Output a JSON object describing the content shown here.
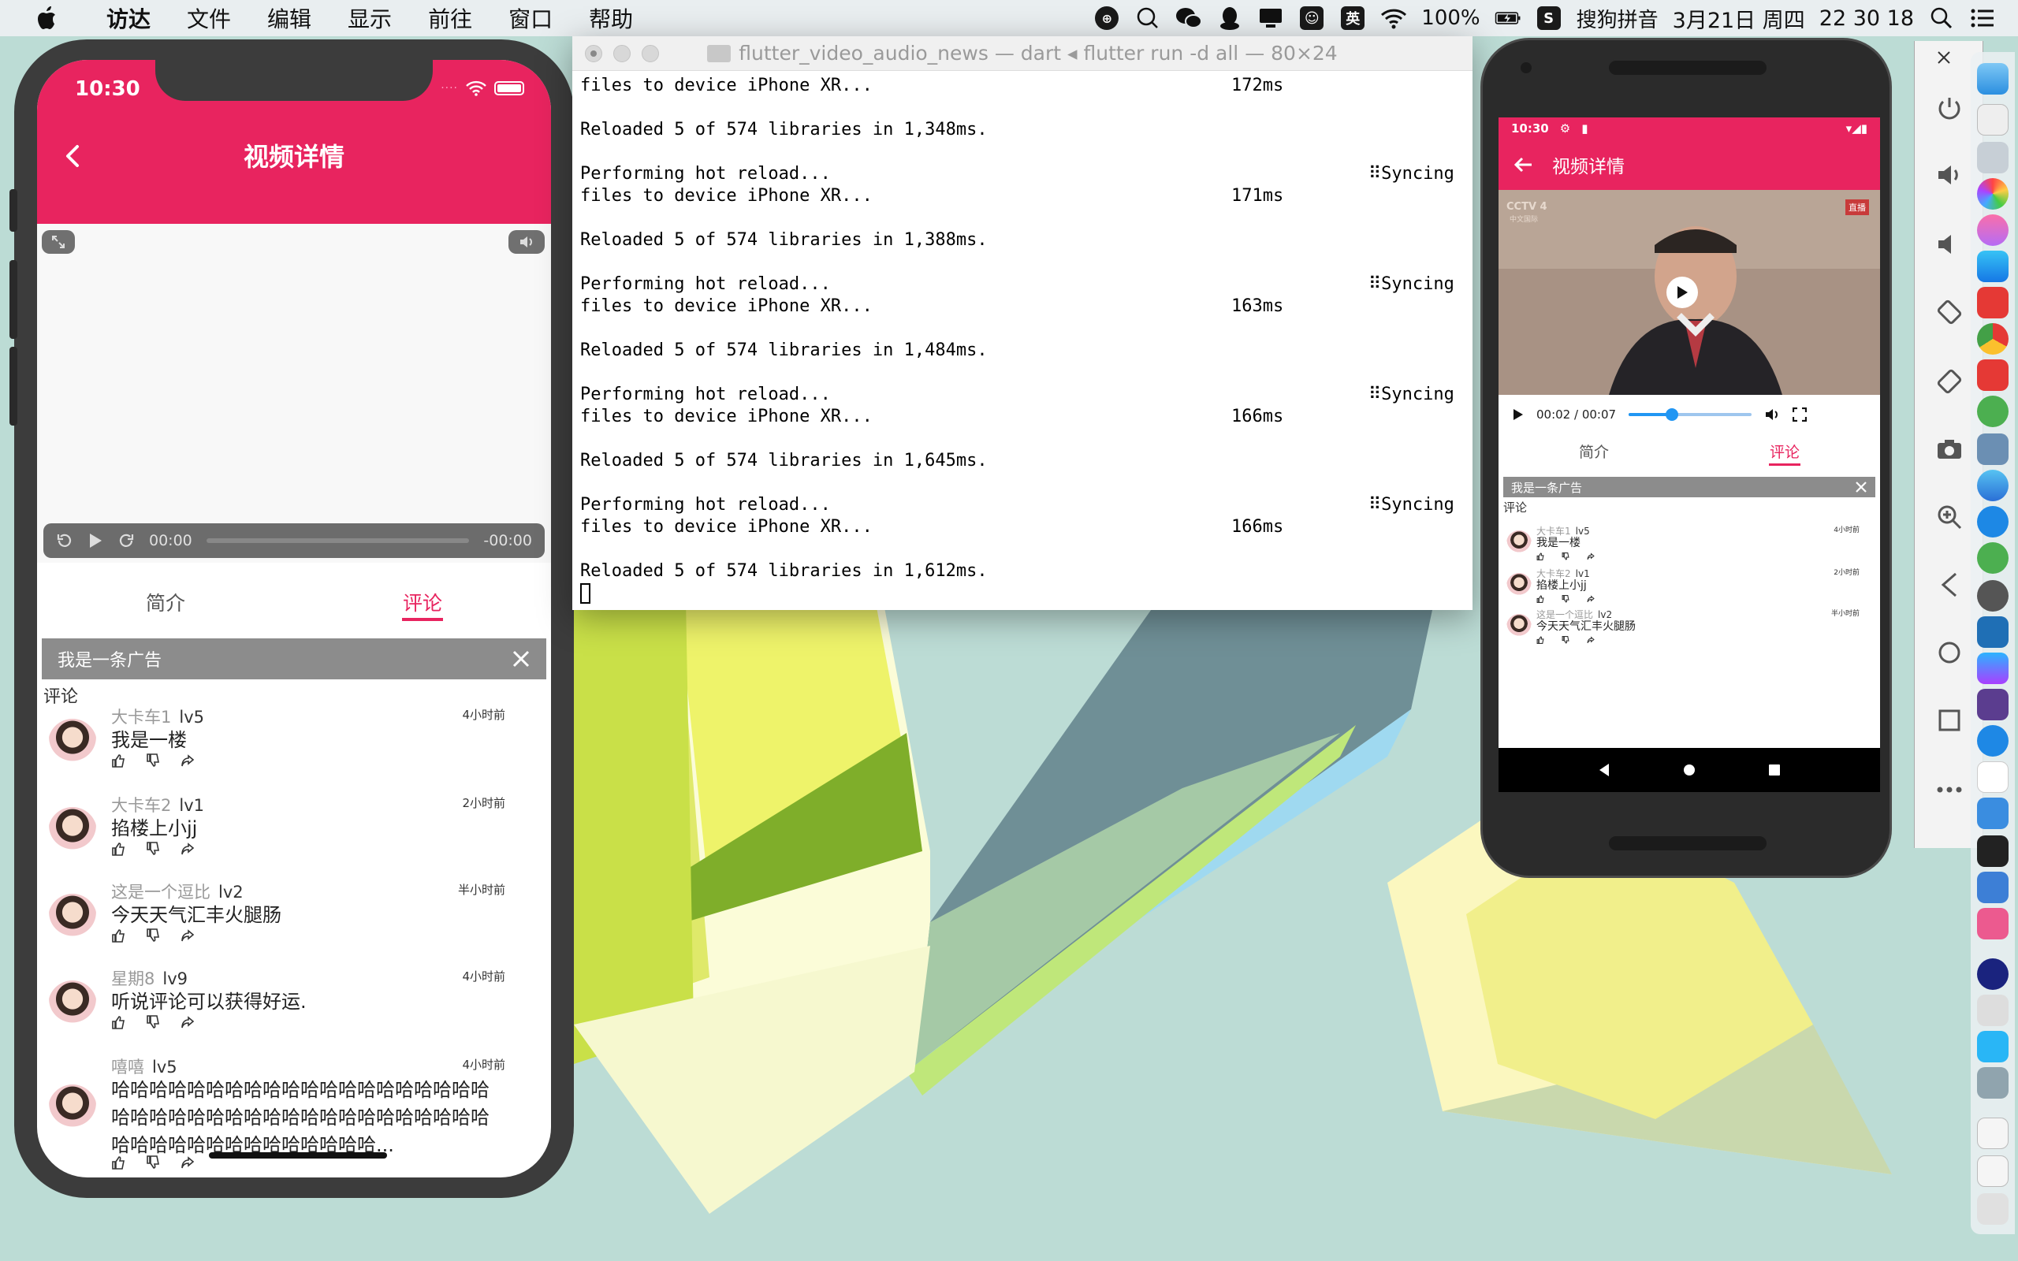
{
  "menubar": {
    "app_name": "访达",
    "menus": [
      "文件",
      "编辑",
      "显示",
      "前往",
      "窗口",
      "帮助"
    ],
    "status": {
      "battery_percent": "100%",
      "input_lang": "英",
      "ime_name": "搜狗拼音",
      "date": "3月21日 周四",
      "clock": "22 30 18"
    }
  },
  "ios": {
    "status_time": "10:30",
    "title": "视频详情",
    "player": {
      "current": "00:00",
      "remaining": "-00:00"
    },
    "tabs": [
      "简介",
      "评论"
    ],
    "active_tab": 1,
    "ad_text": "我是一条广告",
    "comments_heading": "评论",
    "comments": [
      {
        "name": "大卡车1",
        "level": "lv5",
        "time": "4小时前",
        "text": "我是一楼"
      },
      {
        "name": "大卡车2",
        "level": "lv1",
        "time": "2小时前",
        "text": "掐楼上小jj"
      },
      {
        "name": "这是一个逗比",
        "level": "lv2",
        "time": "半小时前",
        "text": "今天天气汇丰火腿肠"
      },
      {
        "name": "星期8",
        "level": "lv9",
        "time": "4小时前",
        "text": "听说评论可以获得好运."
      },
      {
        "name": "嘻嘻",
        "level": "lv5",
        "time": "4小时前",
        "text": "哈哈哈哈哈哈哈哈哈哈哈哈哈哈哈哈哈哈哈哈哈哈哈哈哈哈哈哈哈哈哈哈哈哈哈哈哈哈哈哈哈哈哈哈哈哈哈哈哈哈哈哈哈哈..."
      }
    ]
  },
  "terminal": {
    "title": "flutter_video_audio_news — dart ◂ flutter run -d all — 80×24",
    "lines": [
      {
        "text": "files to device iPhone XR...",
        "right1": "172ms",
        "right2": ""
      },
      {
        "text": "",
        "right1": "",
        "right2": ""
      },
      {
        "text": "Reloaded 5 of 574 libraries in 1,348ms.",
        "right1": "",
        "right2": ""
      },
      {
        "text": "",
        "right1": "",
        "right2": ""
      },
      {
        "text": "Performing hot reload...",
        "right1": "",
        "right2": "⠿Syncing"
      },
      {
        "text": "files to device iPhone XR...",
        "right1": "171ms",
        "right2": ""
      },
      {
        "text": "",
        "right1": "",
        "right2": ""
      },
      {
        "text": "Reloaded 5 of 574 libraries in 1,388ms.",
        "right1": "",
        "right2": ""
      },
      {
        "text": "",
        "right1": "",
        "right2": ""
      },
      {
        "text": "Performing hot reload...",
        "right1": "",
        "right2": "⠿Syncing"
      },
      {
        "text": "files to device iPhone XR...",
        "right1": "163ms",
        "right2": ""
      },
      {
        "text": "",
        "right1": "",
        "right2": ""
      },
      {
        "text": "Reloaded 5 of 574 libraries in 1,484ms.",
        "right1": "",
        "right2": ""
      },
      {
        "text": "",
        "right1": "",
        "right2": ""
      },
      {
        "text": "Performing hot reload...",
        "right1": "",
        "right2": "⠿Syncing"
      },
      {
        "text": "files to device iPhone XR...",
        "right1": "166ms",
        "right2": ""
      },
      {
        "text": "",
        "right1": "",
        "right2": ""
      },
      {
        "text": "Reloaded 5 of 574 libraries in 1,645ms.",
        "right1": "",
        "right2": ""
      },
      {
        "text": "",
        "right1": "",
        "right2": ""
      },
      {
        "text": "Performing hot reload...",
        "right1": "",
        "right2": "⠿Syncing"
      },
      {
        "text": "files to device iPhone XR...",
        "right1": "166ms",
        "right2": ""
      },
      {
        "text": "",
        "right1": "",
        "right2": ""
      },
      {
        "text": "Reloaded 5 of 574 libraries in 1,612ms.",
        "right1": "",
        "right2": ""
      }
    ]
  },
  "android": {
    "status_time": "10:30",
    "title": "视频详情",
    "video_watermark": "CCTV 4",
    "video_sub": "中文国际",
    "live_badge": "直播",
    "player": {
      "position": "00:02 / 00:07",
      "progress": 0.35
    },
    "tabs": [
      "简介",
      "评论"
    ],
    "active_tab": 1,
    "ad_text": "我是一条广告",
    "comments_heading": "评论",
    "comments": [
      {
        "name": "大卡车1",
        "level": "lv5",
        "time": "4小时前",
        "text": "我是一楼"
      },
      {
        "name": "大卡车2",
        "level": "lv1",
        "time": "2小时前",
        "text": "掐楼上小jj"
      },
      {
        "name": "这是一个逗比",
        "level": "lv2",
        "time": "半小时前",
        "text": "今天天气汇丰火腿肠"
      }
    ]
  },
  "colors": {
    "brand": "#e8245f",
    "ad_bar": "#8c8c8c",
    "accent_blue": "#2196f3"
  }
}
